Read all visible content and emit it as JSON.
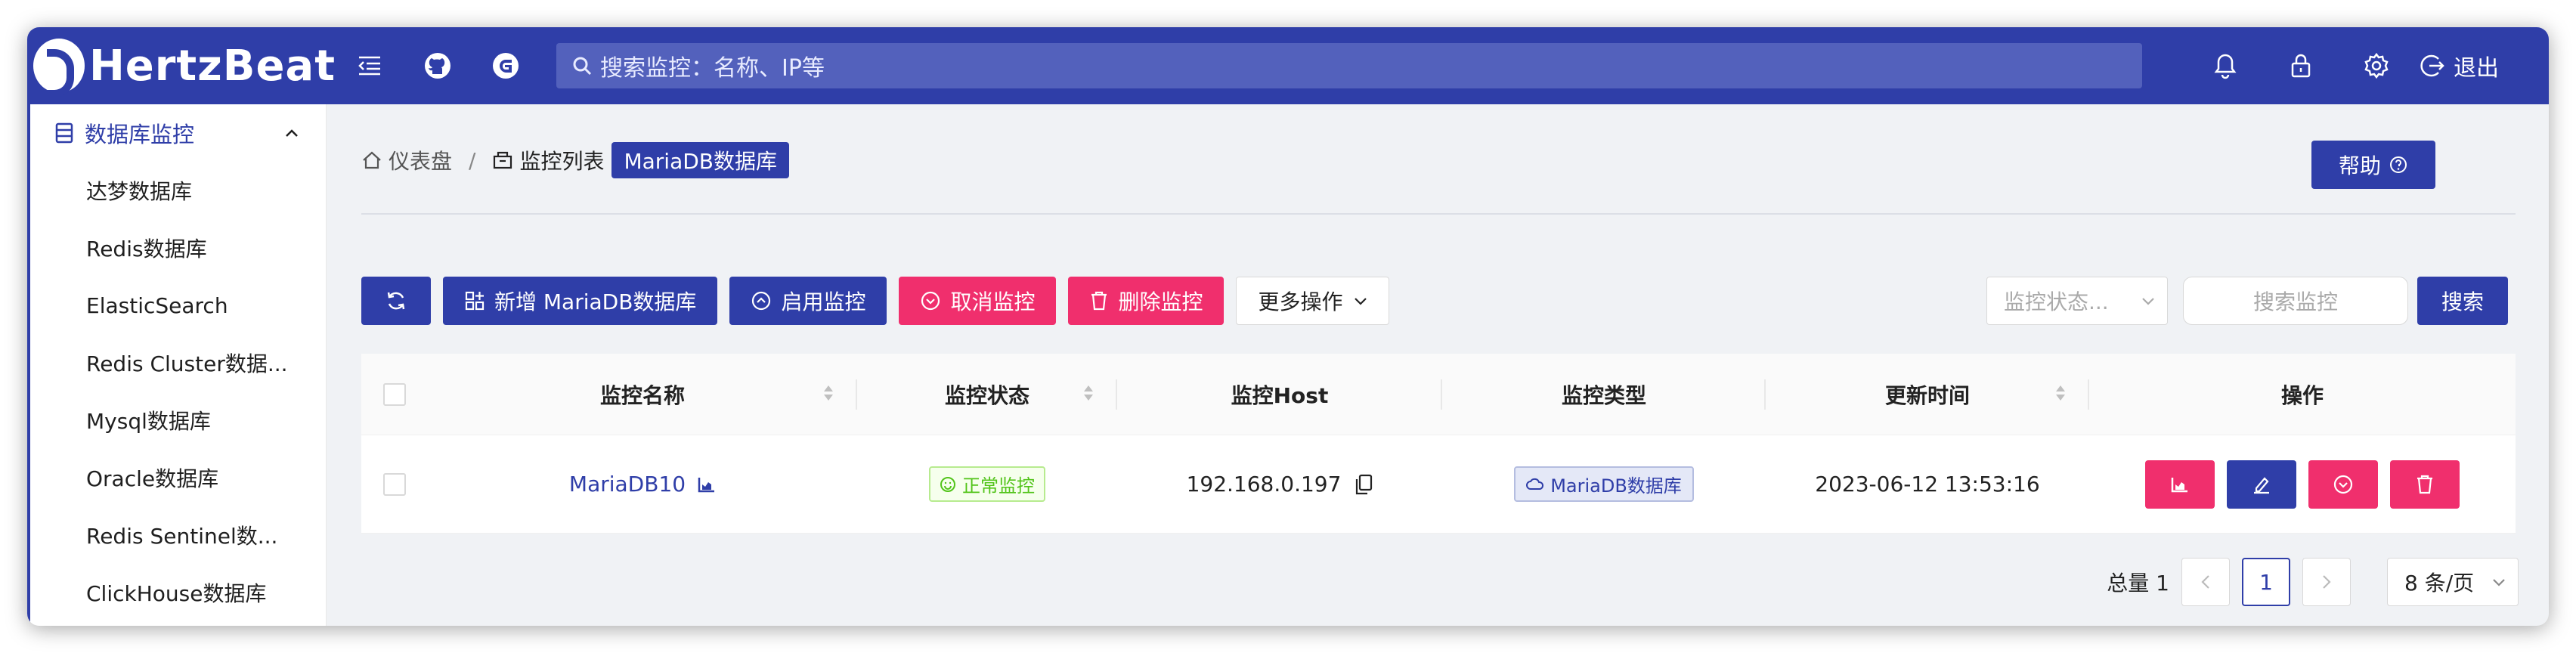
{
  "header": {
    "brand": "HertzBeat",
    "search_placeholder": "搜索监控：名称、IP等",
    "logout_label": "退出"
  },
  "sidebar": {
    "group_label": "数据库监控",
    "items": [
      {
        "label": "达梦数据库"
      },
      {
        "label": "Redis数据库"
      },
      {
        "label": "ElasticSearch"
      },
      {
        "label": "Redis Cluster数据..."
      },
      {
        "label": "Mysql数据库"
      },
      {
        "label": "Oracle数据库"
      },
      {
        "label": "Redis Sentinel数..."
      },
      {
        "label": "ClickHouse数据库"
      }
    ]
  },
  "breadcrumb": {
    "home": "仪表盘",
    "separator": "/",
    "list": "监控列表",
    "tag": "MariaDB数据库"
  },
  "help_label": "帮助",
  "toolbar": {
    "new_label": "新增 MariaDB数据库",
    "enable_label": "启用监控",
    "cancel_label": "取消监控",
    "delete_label": "删除监控",
    "more_label": "更多操作",
    "status_filter_placeholder": "监控状态...",
    "keyword_placeholder": "搜索监控",
    "search_label": "搜索"
  },
  "table": {
    "headers": {
      "name": "监控名称",
      "status": "监控状态",
      "host": "监控Host",
      "type": "监控类型",
      "updated": "更新时间",
      "actions": "操作"
    },
    "rows": [
      {
        "name": "MariaDB10",
        "status": "正常监控",
        "host": "192.168.0.197",
        "type": "MariaDB数据库",
        "updated": "2023-06-12 13:53:16"
      }
    ]
  },
  "pagination": {
    "total_label": "总量 1",
    "current_page": "1",
    "page_size": "8 条/页"
  },
  "colors": {
    "primary": "#2f3ea8",
    "danger": "#f02f6d",
    "success": "#52c41a"
  }
}
